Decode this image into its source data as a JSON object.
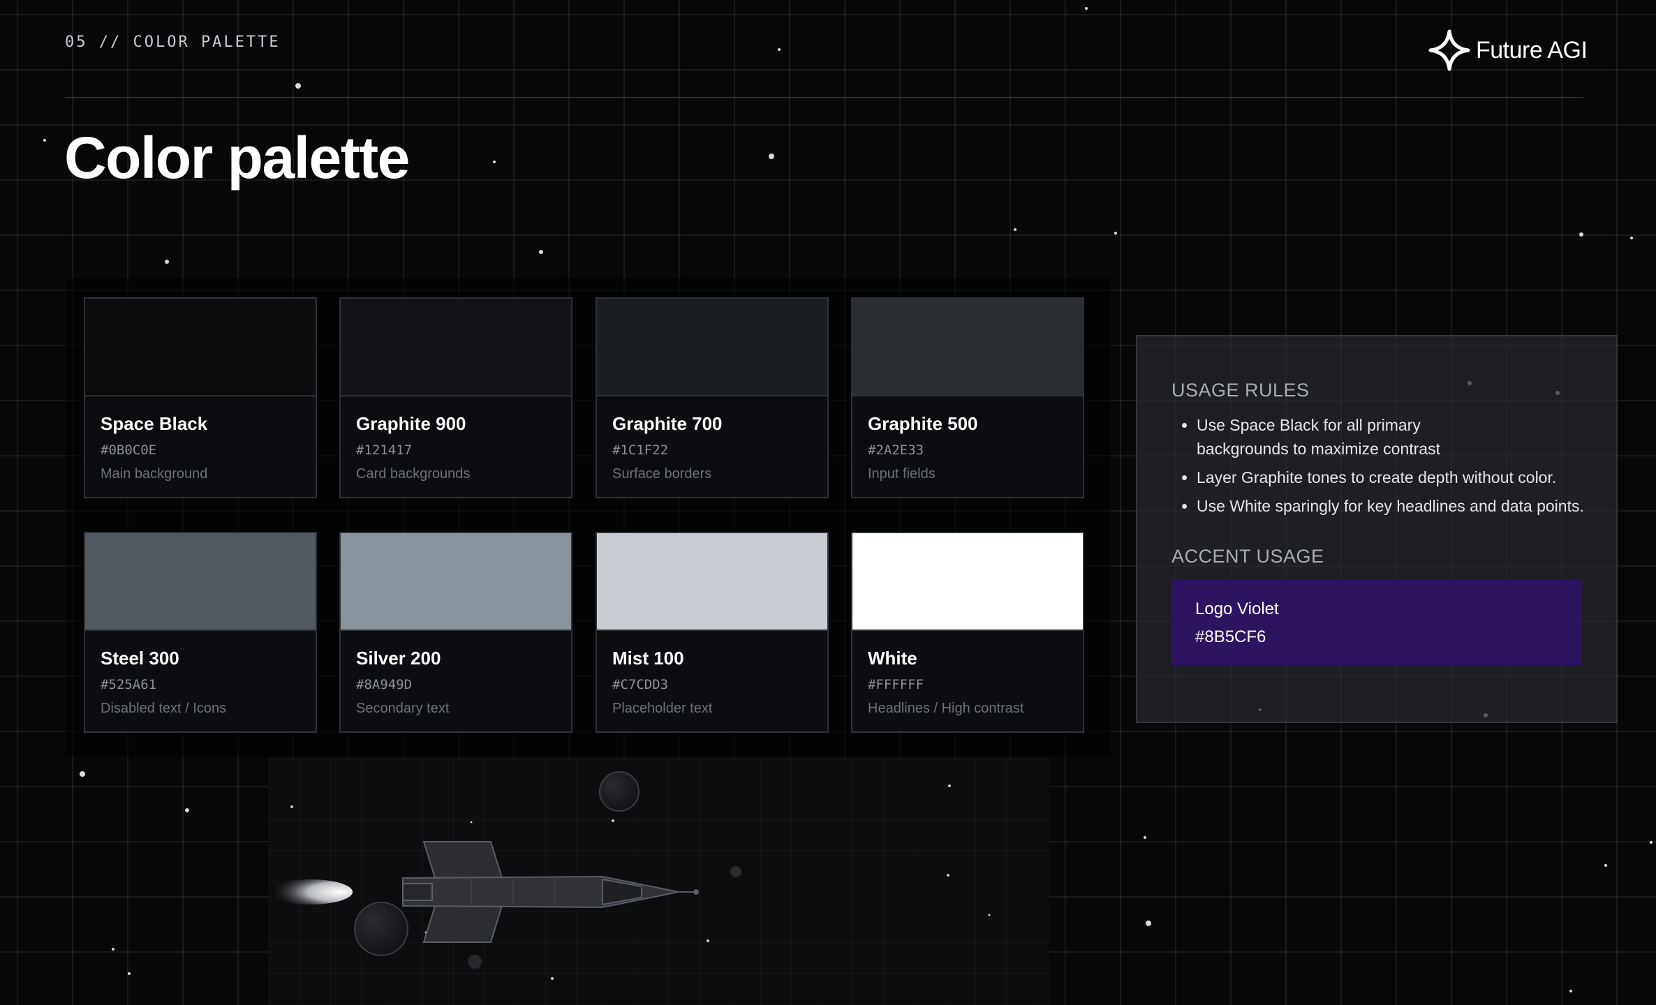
{
  "header": {
    "eyebrow": "05 // COLOR PALETTE",
    "logo_text": "Future AGI",
    "logo_icon": "four-point-star-icon"
  },
  "title": "Color palette",
  "swatches": [
    {
      "name": "Space Black",
      "hex": "#0B0C0E",
      "use": "Main background",
      "color": "#0B0C0E"
    },
    {
      "name": "Graphite 900",
      "hex": "#121417",
      "use": "Card backgrounds",
      "color": "#121417"
    },
    {
      "name": "Graphite 700",
      "hex": "#1C1F22",
      "use": "Surface borders",
      "color": "#1C1F22"
    },
    {
      "name": "Graphite 500",
      "hex": "#2A2E33",
      "use": "Input fields",
      "color": "#2A2E33"
    },
    {
      "name": "Steel 300",
      "hex": "#525A61",
      "use": "Disabled text / Icons",
      "color": "#525A61"
    },
    {
      "name": "Silver 200",
      "hex": "#8A949D",
      "use": "Secondary text",
      "color": "#8A949D"
    },
    {
      "name": "Mist 100",
      "hex": "#C7CDD3",
      "use": "Placeholder text",
      "color": "#C7CDD3"
    },
    {
      "name": "White",
      "hex": "#FFFFFF",
      "use": "Headlines / High contrast",
      "color": "#FFFFFF"
    }
  ],
  "usage": {
    "heading": "USAGE RULES",
    "rules": [
      "Use Space Black for all primary backgrounds to maximize contrast",
      "Layer Graphite tones to create depth without color.",
      "Use White sparingly for key headlines and data points."
    ]
  },
  "accent": {
    "heading": "ACCENT USAGE",
    "name": "Logo Violet",
    "hex": "#8B5CF6",
    "fill": "#2C1461"
  },
  "illustration": {
    "icon": "rocket-illustration-icon"
  }
}
